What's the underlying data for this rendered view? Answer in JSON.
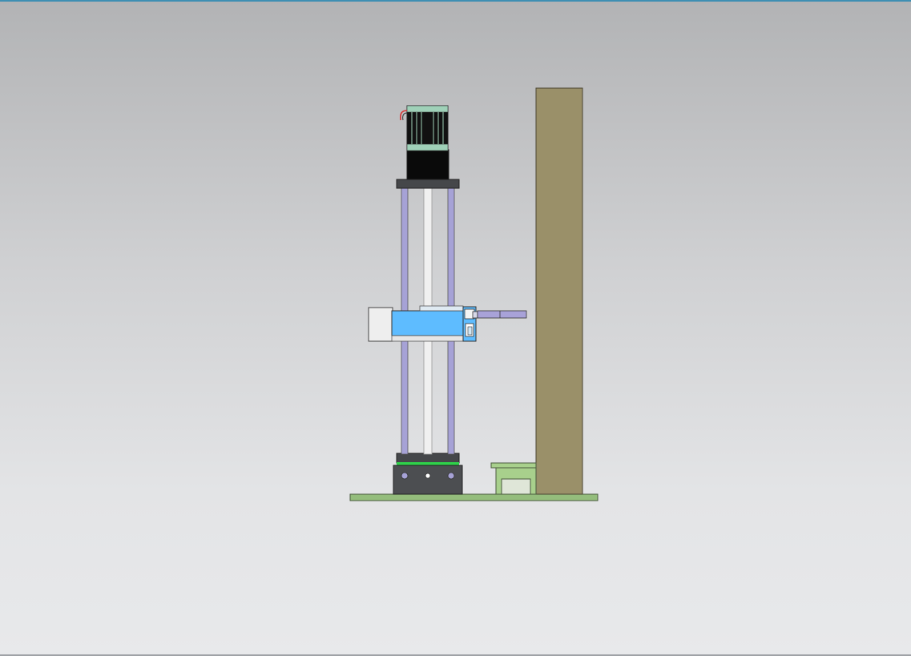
{
  "viewport": {
    "background_top": "#b2b3b5",
    "background_bottom": "#e8e9eb",
    "accent_color": "#3e8fb3"
  },
  "model_colors": {
    "base_plate": "#94bd7c",
    "wall_post": "#9a9069",
    "carriage": "#5ebcff",
    "guide_rod": "#a6a2d6",
    "lead_screw": "#e8e8e8",
    "motor_body": "#0a0a0a",
    "motor_accent": "#9fd1b8",
    "end_plate": "#45474a",
    "coupling_ring": "#2fd14a",
    "bracket_panel": "#a8d08c",
    "probe_arm": "#a8a2d8"
  }
}
